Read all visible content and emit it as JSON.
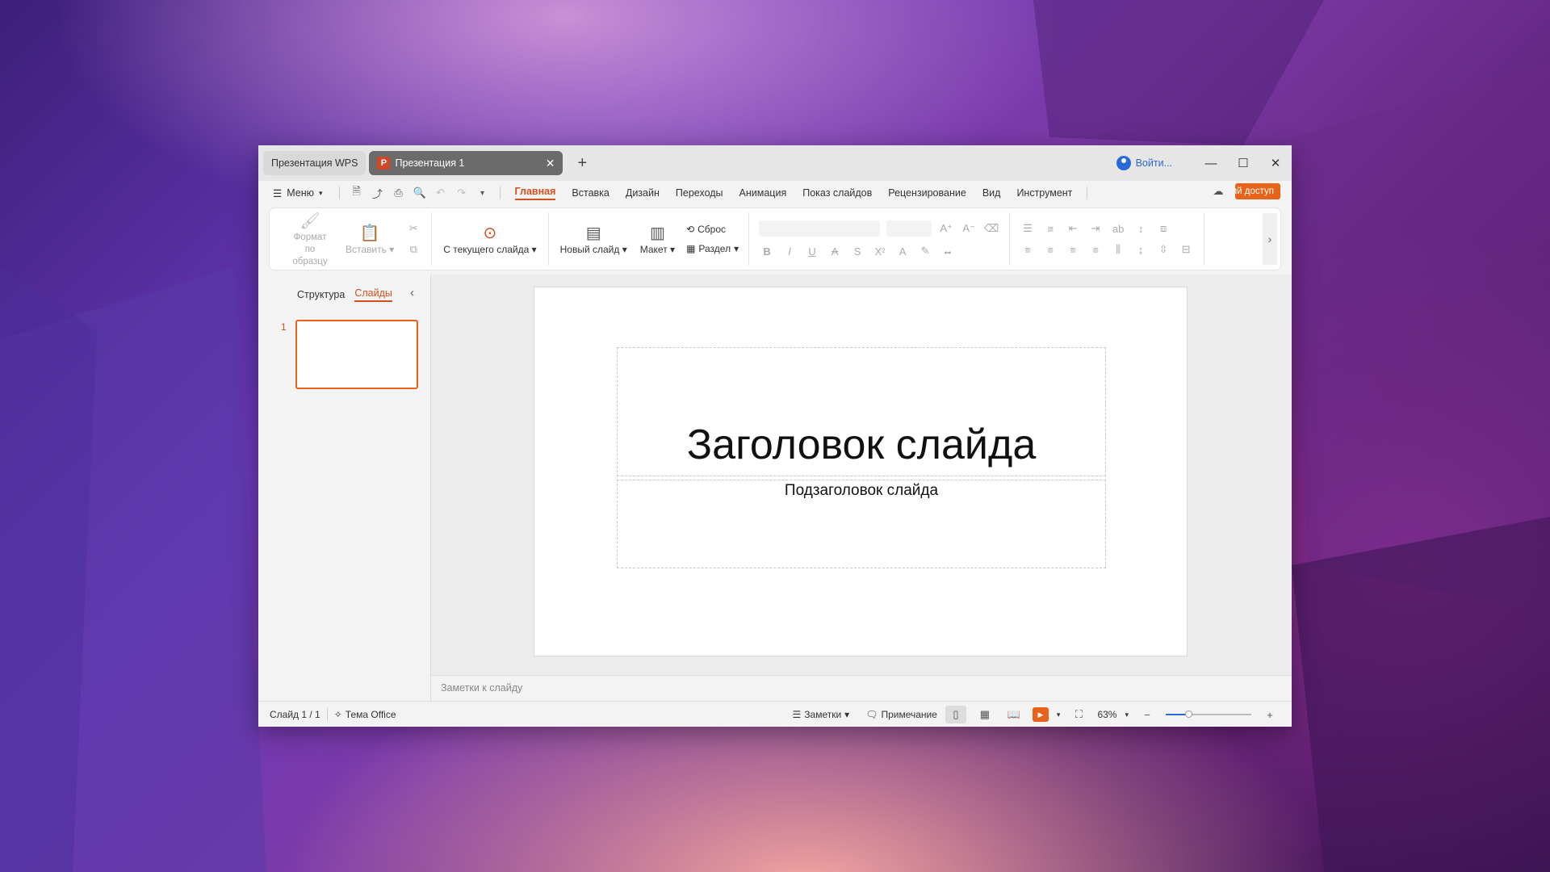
{
  "titlebar": {
    "home_tab": "Презентация WPS",
    "doc_tab": "Презентация 1",
    "login": "Войти..."
  },
  "menubar": {
    "menu_label": "Меню",
    "tabs": [
      "Главная",
      "Вставка",
      "Дизайн",
      "Переходы",
      "Анимация",
      "Показ слайдов",
      "Рецензирование",
      "Вид",
      "Инструмент"
    ],
    "active_tab": "Главная",
    "share_label": "Общий доступ"
  },
  "ribbon": {
    "format_painter": "Формат по образцу",
    "paste": "Вставить",
    "from_current": "С текущего слайда",
    "new_slide": "Новый слайд",
    "layout": "Макет",
    "reset": "Сброс",
    "section": "Раздел"
  },
  "left_panel": {
    "tab_outline": "Структура",
    "tab_slides": "Слайды",
    "slide_number": "1"
  },
  "slide": {
    "title": "Заголовок слайда",
    "subtitle": "Подзаголовок слайда"
  },
  "notes_placeholder": "Заметки к слайду",
  "statusbar": {
    "slide_info": "Слайд 1 / 1",
    "theme": "Тема Office",
    "notes": "Заметки",
    "comment": "Примечание",
    "zoom": "63%",
    "zoom_level": 0.26
  },
  "colors": {
    "accent": "#d2501e",
    "share": "#e8631a",
    "link": "#2a6ad6"
  }
}
